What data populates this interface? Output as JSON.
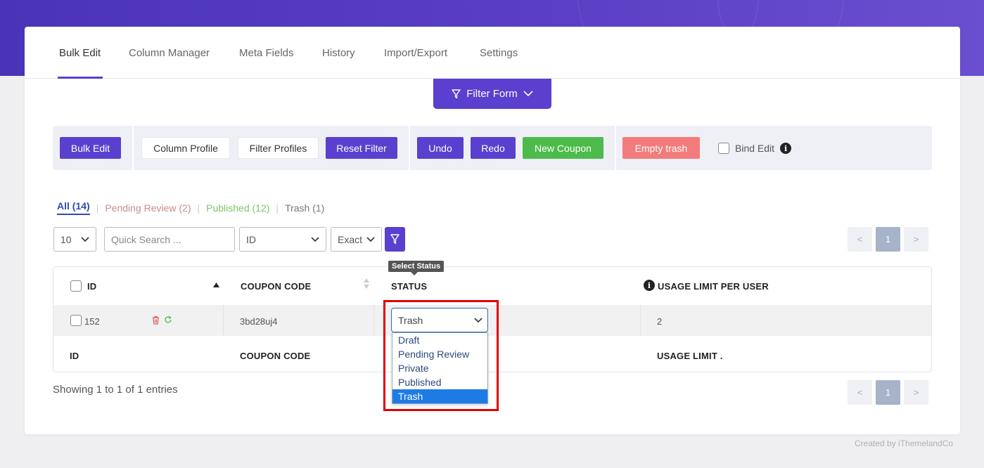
{
  "tabs": [
    {
      "label": "Bulk Edit",
      "active": true
    },
    {
      "label": "Column Manager"
    },
    {
      "label": "Meta Fields"
    },
    {
      "label": "History"
    },
    {
      "label": "Import/Export"
    },
    {
      "label": "Settings"
    }
  ],
  "filter_form": {
    "label": "Filter Form"
  },
  "toolbar": {
    "bulk_edit": "Bulk Edit",
    "column_profile": "Column Profile",
    "filter_profiles": "Filter Profiles",
    "reset_filter": "Reset Filter",
    "undo": "Undo",
    "redo": "Redo",
    "new_coupon": "New Coupon",
    "empty_trash": "Empty trash",
    "bind_edit": "Bind Edit"
  },
  "status_filter": {
    "all": "All (14)",
    "pending": "Pending Review (2)",
    "published": "Published (12)",
    "trash": "Trash (1)"
  },
  "controls": {
    "per_page": "10",
    "search_placeholder": "Quick Search ...",
    "field": "ID",
    "match": "Exact"
  },
  "pagination": {
    "prev": "<",
    "current": "1",
    "next": ">"
  },
  "table": {
    "headers": {
      "id": "ID",
      "coupon_code": "COUPON CODE",
      "status": "STATUS",
      "usage_limit": "USAGE LIMIT PER USER"
    },
    "row": {
      "id": "152",
      "coupon_code": "3bd28uj4",
      "status": "Trash",
      "usage_limit": "2"
    },
    "footers": {
      "id": "ID",
      "coupon_code": "COUPON CODE",
      "usage_limit": "USAGE LIMIT ."
    }
  },
  "tooltip": "Select Status",
  "status_options": [
    "Draft",
    "Pending Review",
    "Private",
    "Published",
    "Trash"
  ],
  "selected_status": "Trash",
  "showing": "Showing 1 to 1 of 1 entries",
  "credit": "Created by iThemelandCo",
  "colors": {
    "accent": "#5b3fcf",
    "green": "#4cbb4b",
    "pink": "#f47b7b",
    "highlight": "#e10000"
  }
}
